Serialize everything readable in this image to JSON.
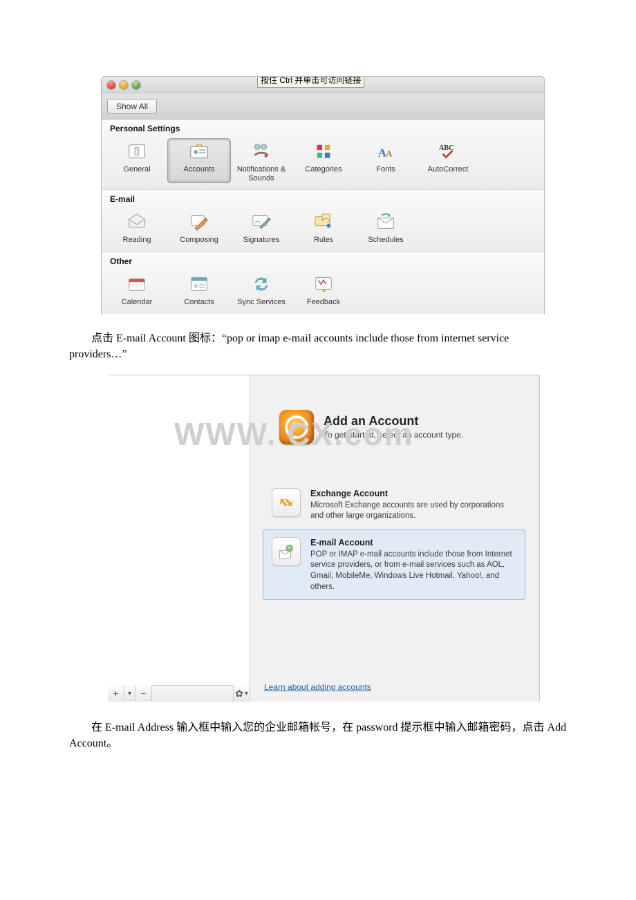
{
  "prefs": {
    "tooltip": "按住 Ctrl 并单击可访问链接",
    "show_all": "Show All",
    "section_personal": "Personal Settings",
    "section_email": "E-mail",
    "section_other": "Other",
    "personal_items": {
      "general": "General",
      "accounts": "Accounts",
      "notifications": "Notifications & Sounds",
      "categories": "Categories",
      "fonts": "Fonts",
      "autocorrect": "AutoCorrect"
    },
    "email_items": {
      "reading": "Reading",
      "composing": "Composing",
      "signatures": "Signatures",
      "rules": "Rules",
      "schedules": "Schedules"
    },
    "other_items": {
      "calendar": "Calendar",
      "contacts": "Contacts",
      "sync": "Sync Services",
      "feedback": "Feedback"
    }
  },
  "doc": {
    "p1": "点击 E-mail Account 图标：“pop or imap e-mail accounts include those from internet  service providers…”",
    "p2": "在 E-mail Address 输入框中输入您的企业邮箱帐号，在 password 提示框中输入邮箱密码，点击 Add Account。"
  },
  "acct": {
    "watermark": "WWW.       CX.com",
    "title": "Add an Account",
    "subtitle": "To get started, select an account type.",
    "exchange_title": "Exchange Account",
    "exchange_desc": "Microsoft Exchange accounts are used by corporations and other large organizations.",
    "email_title": "E-mail Account",
    "email_desc": "POP or IMAP e-mail accounts include those from Internet service providers, or from e-mail services such as AOL, Gmail, MobileMe, Windows Live Hotmail, Yahoo!, and others.",
    "learn": "Learn about adding accounts",
    "buttons": {
      "plus": "+",
      "dropdown": "▾",
      "minus": "−",
      "gear": "✿",
      "geardrop": "▾"
    }
  }
}
